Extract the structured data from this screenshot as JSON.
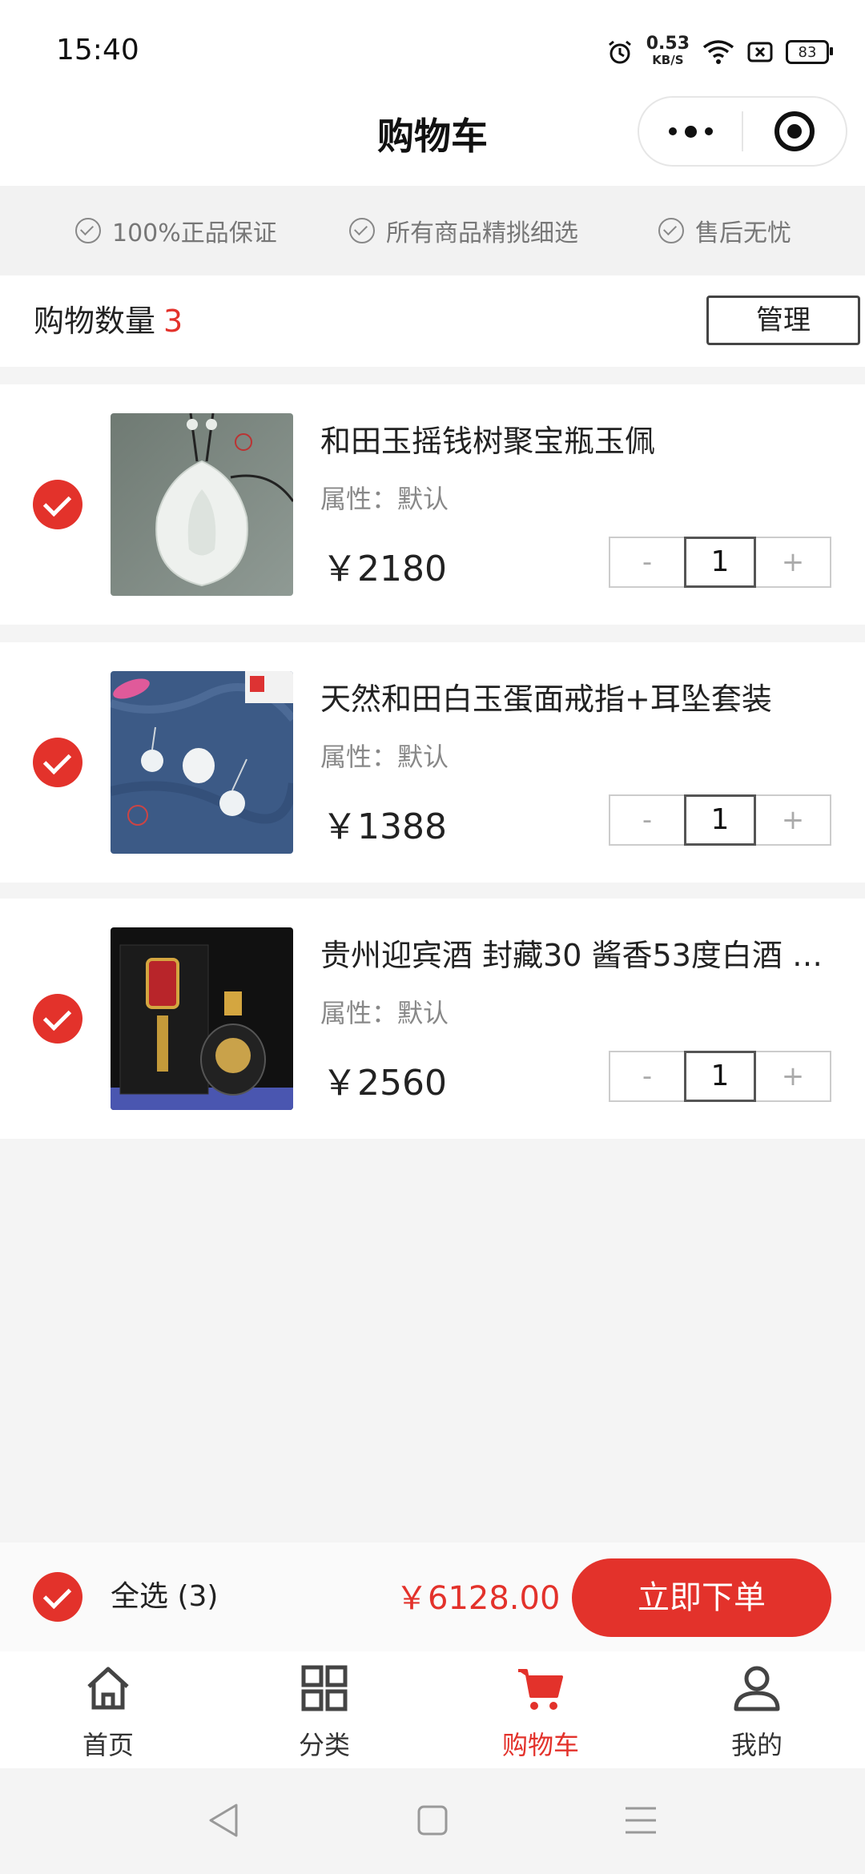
{
  "status_bar": {
    "time": "15:40",
    "network_speed": "0.53",
    "network_unit": "KB/S",
    "battery": "83",
    "icons": [
      "alarm-icon",
      "wifi-icon",
      "sim-icon",
      "battery-icon"
    ]
  },
  "nav": {
    "title": "购物车",
    "capsule_icons": [
      "more-dots-icon",
      "target-icon"
    ]
  },
  "guarantees": [
    "100%正品保证",
    "所有商品精挑细选",
    "售后无忧"
  ],
  "cart_header": {
    "label": "购物数量",
    "count": "3",
    "manage_label": "管理"
  },
  "items": [
    {
      "name": "和田玉摇钱树聚宝瓶玉佩",
      "attr": "属性：默认",
      "price": "￥2180",
      "minus": "-",
      "qty": "1",
      "plus": "+",
      "image_desc": "jade-pendant-image"
    },
    {
      "name": "天然和田白玉蛋面戒指+耳坠套装",
      "attr": "属性：默认",
      "price": "￥1388",
      "minus": "-",
      "qty": "1",
      "plus": "+",
      "image_desc": "jade-ring-earrings-image"
    },
    {
      "name": "贵州迎宾酒 封藏30 酱香53度白酒 …",
      "attr": "属性：默认",
      "price": "￥2560",
      "minus": "-",
      "qty": "1",
      "plus": "+",
      "image_desc": "baijiu-bottle-image"
    }
  ],
  "bottom": {
    "select_all": "全选 (3)",
    "total": "￥6128.00",
    "order_button": "立即下单"
  },
  "tabs": [
    {
      "label": "首页",
      "icon": "home-icon",
      "active": false
    },
    {
      "label": "分类",
      "icon": "grid-icon",
      "active": false
    },
    {
      "label": "购物车",
      "icon": "cart-icon",
      "active": true
    },
    {
      "label": "我的",
      "icon": "user-icon",
      "active": false
    }
  ],
  "colors": {
    "accent": "#e3322b",
    "background": "#f4f4f4"
  }
}
